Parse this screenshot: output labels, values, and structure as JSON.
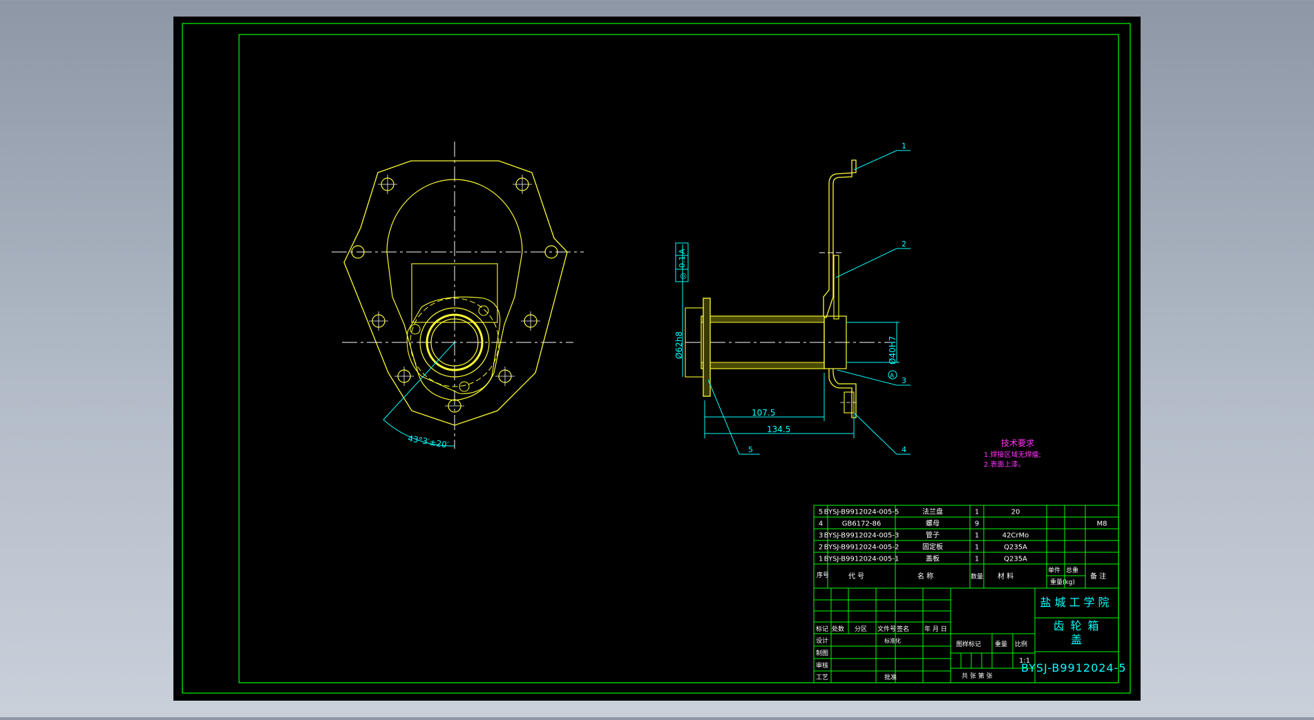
{
  "colors": {
    "background": "#000000",
    "frame": "#00ff00",
    "part": "#ffff33",
    "center_line": "#ffffff",
    "leader": "#00ffff",
    "notes": "#ff33ff",
    "title_cn": "#00ffff"
  },
  "front_view": {
    "angle_dim": "43°3′±20′"
  },
  "section_view": {
    "tolerance_frame": [
      "◎",
      "0.1",
      "A"
    ],
    "dia_left": "Ø62h8",
    "dia_right": "Ø40H7",
    "datum": "A",
    "dim_1": "107.5",
    "dim_2": "134.5",
    "balloons": [
      "1",
      "2",
      "3",
      "4",
      "5"
    ]
  },
  "technical_requirements": {
    "title": "技术要求",
    "items": [
      "1.焊接区域无焊瘤;",
      "2.表面上漆。"
    ]
  },
  "bom": {
    "rows": [
      {
        "no": "5",
        "code": "BYSJ-B9912024-005-5",
        "name": "法兰盘",
        "qty": "1",
        "material": "20",
        "unit_wt": "",
        "total_wt": "",
        "note": ""
      },
      {
        "no": "4",
        "code": "GB6172-86",
        "name": "螺母",
        "qty": "9",
        "material": "",
        "unit_wt": "",
        "total_wt": "",
        "note": "M8"
      },
      {
        "no": "3",
        "code": "BYSJ-B9912024-005-3",
        "name": "管子",
        "qty": "1",
        "material": "42CrMo",
        "unit_wt": "",
        "total_wt": "",
        "note": ""
      },
      {
        "no": "2",
        "code": "BYSJ-B9912024-005-2",
        "name": "固定板",
        "qty": "1",
        "material": "Q235A",
        "unit_wt": "",
        "total_wt": "",
        "note": ""
      },
      {
        "no": "1",
        "code": "BYSJ-B9912024-005-1",
        "name": "盖板",
        "qty": "1",
        "material": "Q235A",
        "unit_wt": "",
        "total_wt": "",
        "note": ""
      }
    ],
    "headers": {
      "no": "序号",
      "code": "代  号",
      "name": "名  称",
      "qty": "数量",
      "material": "材  料",
      "unit_wt": "单件",
      "total_wt": "总重",
      "weight": "重量(kg)",
      "note": "备  注"
    }
  },
  "title_block": {
    "school": "盐城工学院",
    "drawing_title_1": "齿轮箱",
    "drawing_title_2": "盖",
    "drawing_no": "BYSJ-B9912024-5",
    "scale": "1:1",
    "labels": {
      "mark": "标记",
      "count": "处数",
      "zone": "分区",
      "doc_no": "文件号",
      "sign": "签名",
      "date": "年 月 日",
      "design": "设计",
      "standardize": "标准化",
      "draw": "制图",
      "review": "审核",
      "process": "工艺",
      "approve": "批准",
      "stage_mark": "图样标记",
      "weight": "重量",
      "scale_label": "比例",
      "sheet": "共  张  第  张"
    }
  }
}
